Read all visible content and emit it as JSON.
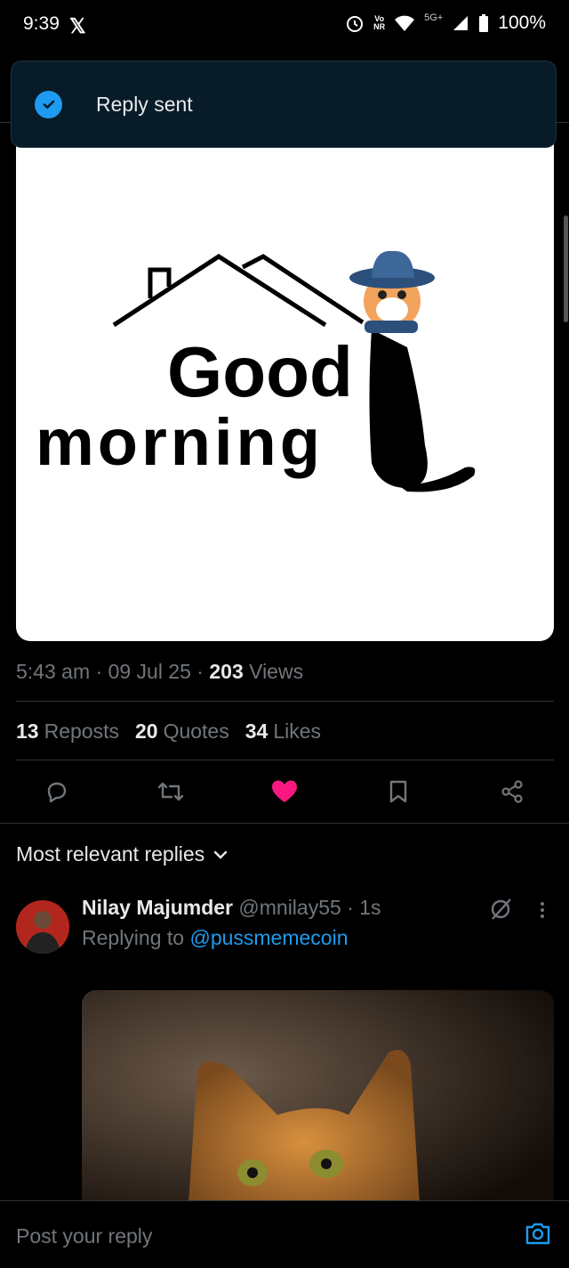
{
  "status_bar": {
    "time": "9:39",
    "app_icon": "x-logo",
    "volte_top": "Vo",
    "volte_bottom": "NR",
    "network": "5G+",
    "battery": "100%"
  },
  "toast": {
    "message": "Reply sent",
    "icon": "check-circle-icon"
  },
  "post": {
    "image_text_line1": "Good",
    "image_text_line2": "morning",
    "time": "5:43 am",
    "date": "09 Jul 25",
    "views_count": "203",
    "views_label": "Views",
    "reposts_count": "13",
    "reposts_label": "Reposts",
    "quotes_count": "20",
    "quotes_label": "Quotes",
    "likes_count": "34",
    "likes_label": "Likes",
    "liked": true
  },
  "replies": {
    "sort_label": "Most relevant replies",
    "items": [
      {
        "name": "Nilay Majumder",
        "handle": "@mnilay55",
        "age": "1s",
        "replying_prefix": "Replying to",
        "replying_to": "@pussmemecoin"
      }
    ]
  },
  "composer": {
    "placeholder": "Post your reply"
  },
  "colors": {
    "accent": "#1d9bf0",
    "like": "#f91880",
    "toast_bg": "#081b29"
  }
}
